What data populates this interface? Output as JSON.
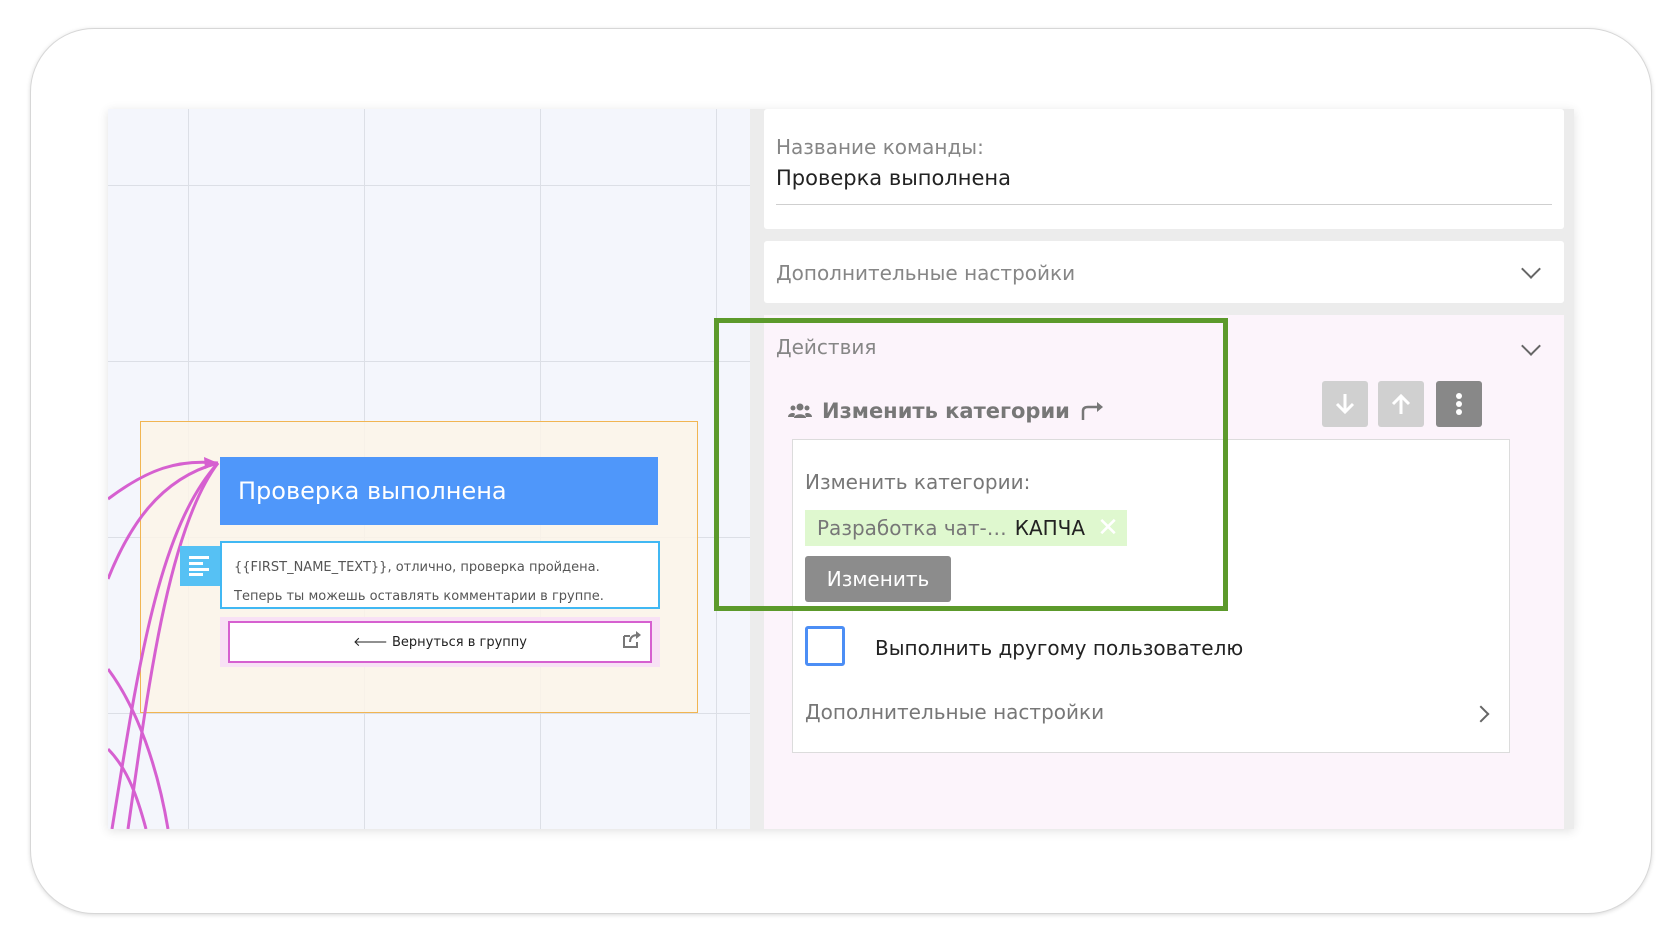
{
  "canvas": {
    "node_title": "Проверка выполнена",
    "message_line1": "{{FIRST_NAME_TEXT}}, отлично, проверка пройдена.",
    "message_line2": "Теперь ты можешь оставлять комментарии в группе.",
    "link_button_label": "🡐 Вернуться в группу"
  },
  "panel": {
    "command_name_label": "Название команды:",
    "command_name_value": "Проверка выполнена",
    "additional_settings_label": "Дополнительные настройки",
    "actions_label": "Действия",
    "action": {
      "title": "Изменить категории",
      "body_label": "Изменить категории:",
      "tag_category": "Разработка чат-…",
      "tag_value": "КАПЧА",
      "change_button": "Изменить",
      "other_user_label": "Выполнить другому пользователю",
      "additional_settings_label": "Дополнительные настройки"
    }
  },
  "colors": {
    "node_blue": "#4f97fa",
    "highlight_green": "#5c9a2b",
    "tag_bg": "#dff8cf",
    "connector_pink": "#d660d0"
  },
  "icons": [
    "text-block-icon",
    "share-icon",
    "users-icon",
    "redirect-arrow-icon",
    "arrow-down-icon",
    "arrow-up-icon",
    "more-vertical-icon",
    "remove-tag-icon",
    "chevron-down-icon",
    "chevron-right-icon",
    "arrow-left-icon"
  ]
}
